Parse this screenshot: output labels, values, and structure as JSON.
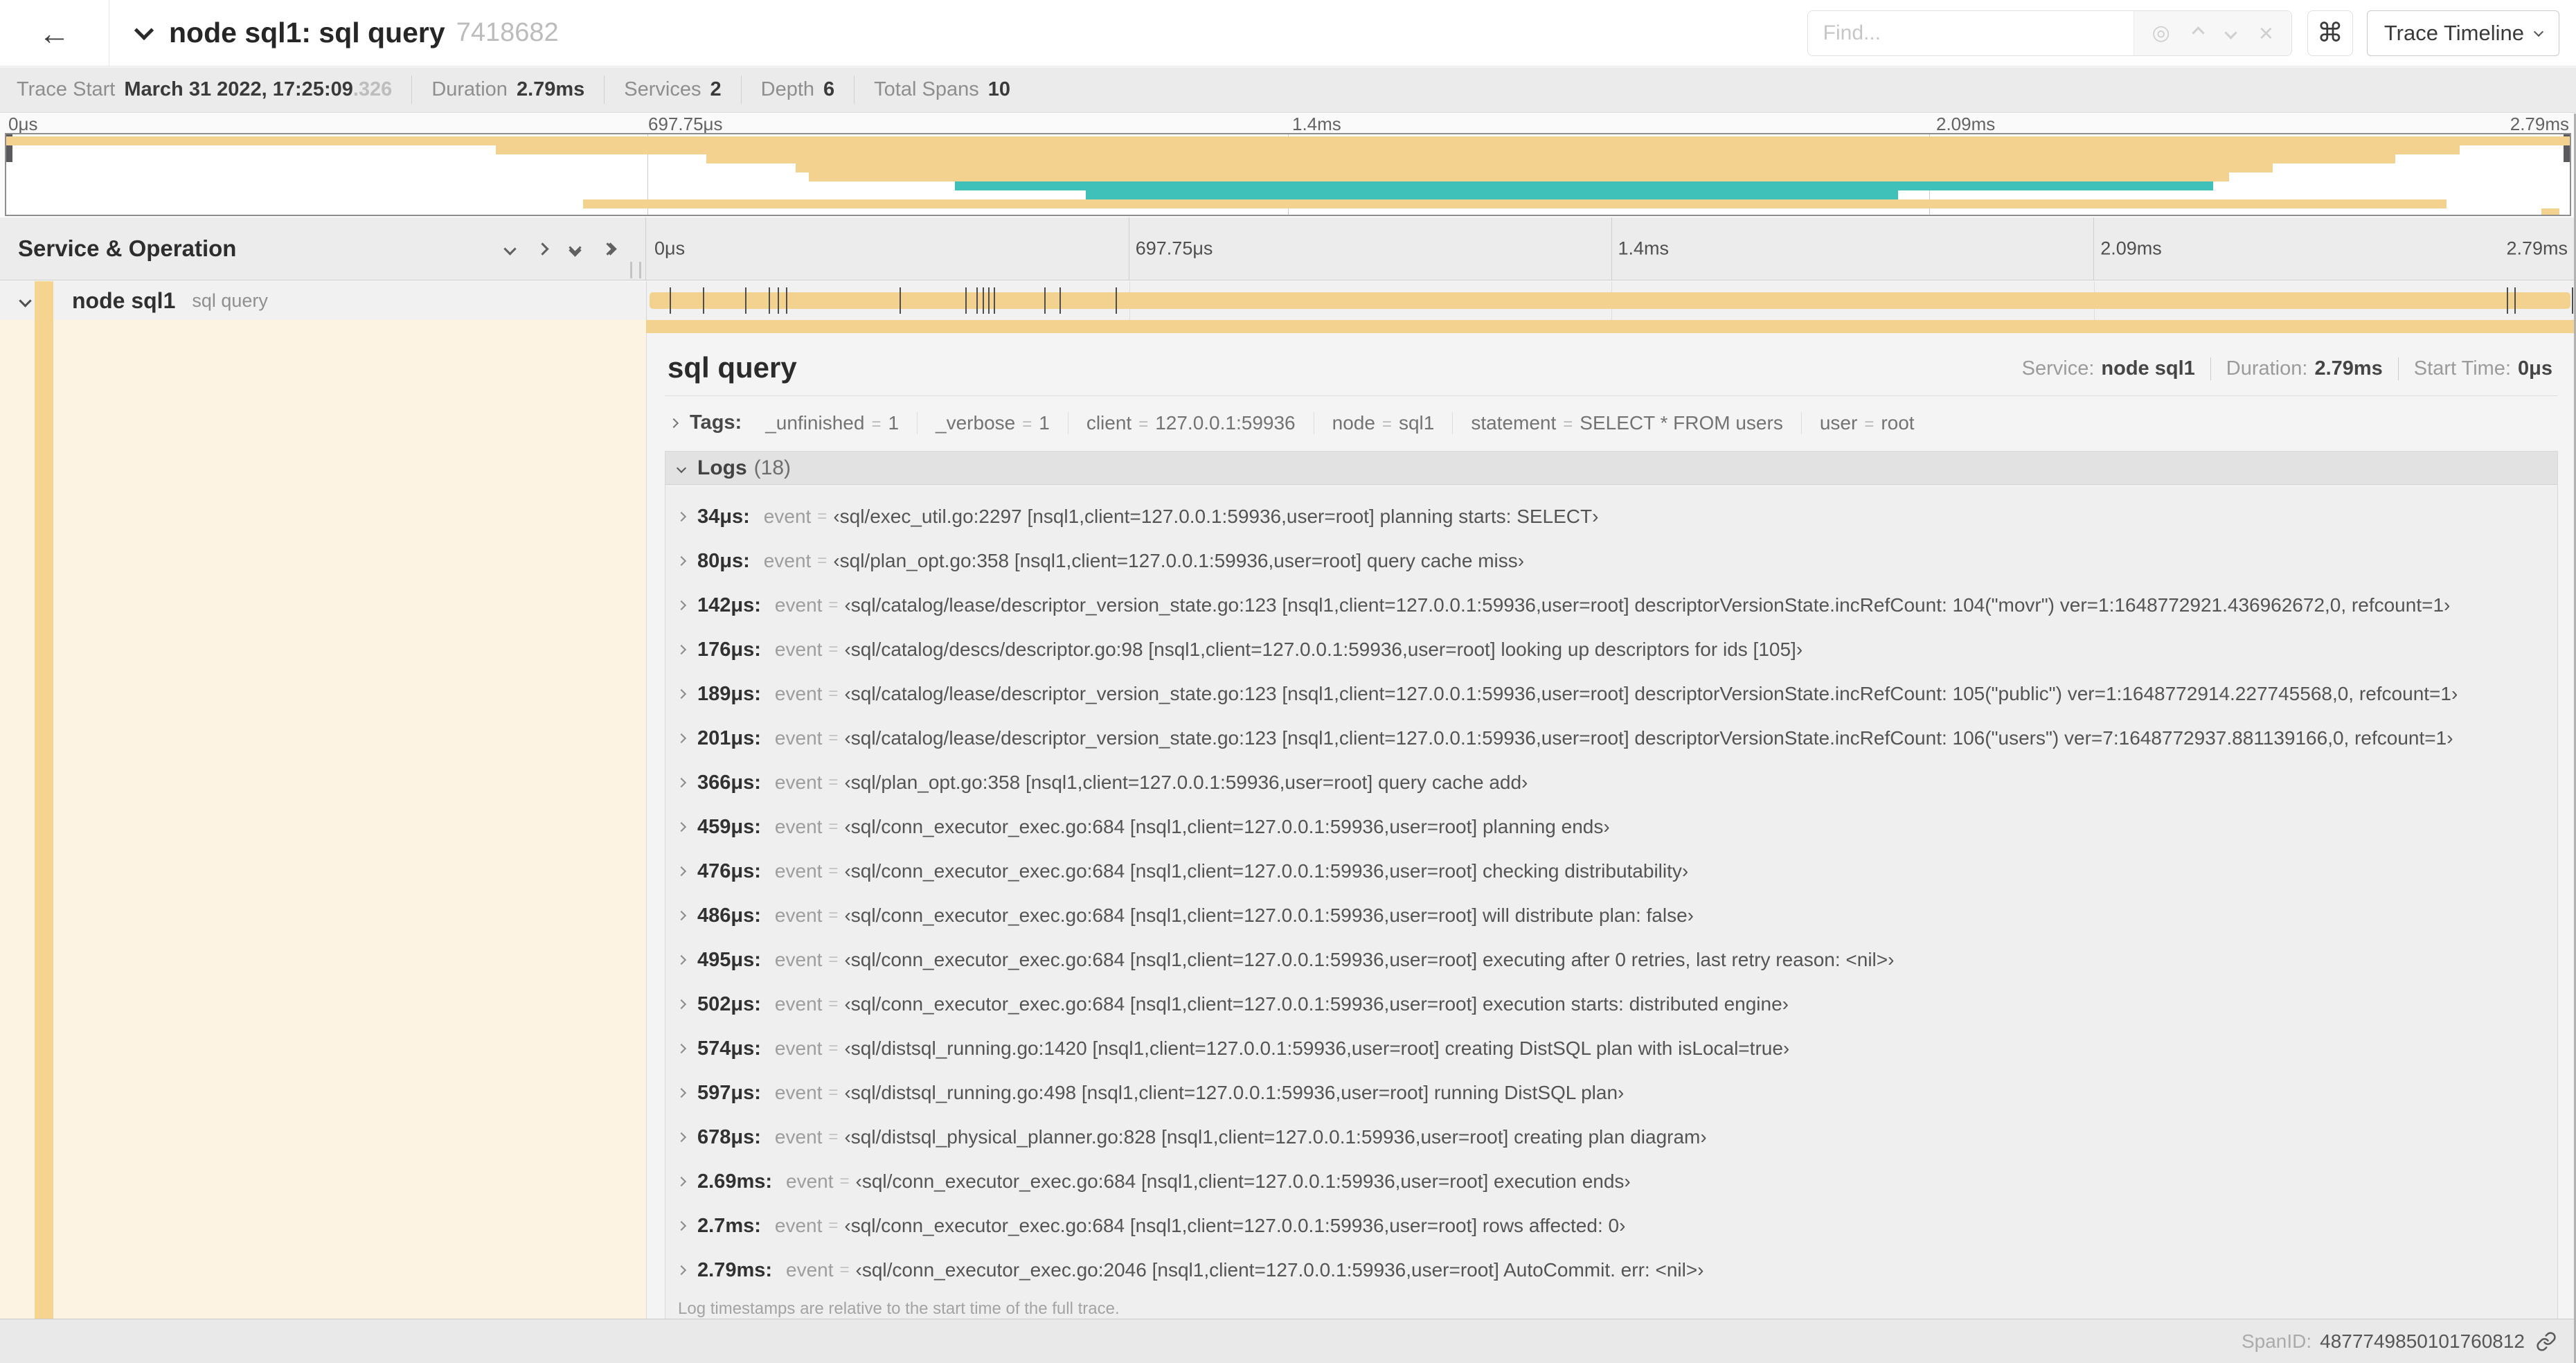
{
  "colors": {
    "tan": "#f2d28e",
    "teal": "#3fc1b9",
    "tan_pale": "#fdf3e2",
    "tan_stripe": "#f5d48f"
  },
  "header": {
    "back_icon": "back-arrow",
    "title": "node sql1: sql query",
    "trace_id": "7418682",
    "find_placeholder": "Find...",
    "shortcut_key": "⌘",
    "view_button": "Trace Timeline"
  },
  "summary": {
    "items": [
      {
        "label": "Trace Start",
        "value": "March 31 2022, 17:25:09",
        "value_muted": ".326"
      },
      {
        "label": "Duration",
        "value": "2.79ms"
      },
      {
        "label": "Services",
        "value": "2"
      },
      {
        "label": "Depth",
        "value": "6"
      },
      {
        "label": "Total Spans",
        "value": "10"
      }
    ]
  },
  "ruler": {
    "labels": [
      "0μs",
      "697.75μs",
      "1.4ms",
      "2.09ms",
      "2.79ms"
    ]
  },
  "minimap": {
    "bars": [
      {
        "row": 0,
        "start": 0,
        "end": 100,
        "color": "tan"
      },
      {
        "row": 1,
        "start": 19.1,
        "end": 95.7,
        "color": "tan"
      },
      {
        "row": 2,
        "start": 27.3,
        "end": 93.2,
        "color": "tan"
      },
      {
        "row": 3,
        "start": 30.8,
        "end": 88.4,
        "color": "tan"
      },
      {
        "row": 4,
        "start": 31.3,
        "end": 86.7,
        "color": "tan"
      },
      {
        "row": 5,
        "start": 37.0,
        "end": 86.1,
        "color": "teal"
      },
      {
        "row": 6,
        "start": 42.1,
        "end": 73.8,
        "color": "teal"
      },
      {
        "row": 7,
        "start": 22.5,
        "end": 95.2,
        "color": "tan"
      },
      {
        "row": 8,
        "start": 98.9,
        "end": 99.6,
        "color": "tan"
      }
    ]
  },
  "timeline_header": {
    "label": "Service & Operation"
  },
  "span_row": {
    "service": "node sql1",
    "operation": "sql query",
    "ticks_pct": [
      1.2,
      2.9,
      5.1,
      6.3,
      6.8,
      7.2,
      13.1,
      16.5,
      17.1,
      17.4,
      17.7,
      18.0,
      20.6,
      21.4,
      24.3,
      96.4,
      96.8,
      99.8
    ]
  },
  "detail": {
    "title": "sql query",
    "service_label": "Service:",
    "service": "node sql1",
    "duration_label": "Duration:",
    "duration": "2.79ms",
    "start_label": "Start Time:",
    "start": "0μs",
    "tags_label": "Tags:",
    "tags": [
      {
        "key": "_unfinished",
        "value": "1"
      },
      {
        "key": "_verbose",
        "value": "1"
      },
      {
        "key": "client",
        "value": "127.0.0.1:59936"
      },
      {
        "key": "node",
        "value": "sql1"
      },
      {
        "key": "statement",
        "value": "SELECT * FROM users"
      },
      {
        "key": "user",
        "value": "root"
      }
    ],
    "logs_label": "Logs",
    "logs_count": "(18)",
    "logs": [
      {
        "t": "34μs:",
        "k": "event",
        "v": "‹sql/exec_util.go:2297 [nsql1,client=127.0.0.1:59936,user=root] planning starts: SELECT›"
      },
      {
        "t": "80μs:",
        "k": "event",
        "v": "‹sql/plan_opt.go:358 [nsql1,client=127.0.0.1:59936,user=root] query cache miss›"
      },
      {
        "t": "142μs:",
        "k": "event",
        "v": "‹sql/catalog/lease/descriptor_version_state.go:123 [nsql1,client=127.0.0.1:59936,user=root] descriptorVersionState.incRefCount: 104(\"movr\") ver=1:1648772921.436962672,0, refcount=1›"
      },
      {
        "t": "176μs:",
        "k": "event",
        "v": "‹sql/catalog/descs/descriptor.go:98 [nsql1,client=127.0.0.1:59936,user=root] looking up descriptors for ids [105]›"
      },
      {
        "t": "189μs:",
        "k": "event",
        "v": "‹sql/catalog/lease/descriptor_version_state.go:123 [nsql1,client=127.0.0.1:59936,user=root] descriptorVersionState.incRefCount: 105(\"public\") ver=1:1648772914.227745568,0, refcount=1›"
      },
      {
        "t": "201μs:",
        "k": "event",
        "v": "‹sql/catalog/lease/descriptor_version_state.go:123 [nsql1,client=127.0.0.1:59936,user=root] descriptorVersionState.incRefCount: 106(\"users\") ver=7:1648772937.881139166,0, refcount=1›"
      },
      {
        "t": "366μs:",
        "k": "event",
        "v": "‹sql/plan_opt.go:358 [nsql1,client=127.0.0.1:59936,user=root] query cache add›"
      },
      {
        "t": "459μs:",
        "k": "event",
        "v": "‹sql/conn_executor_exec.go:684 [nsql1,client=127.0.0.1:59936,user=root] planning ends›"
      },
      {
        "t": "476μs:",
        "k": "event",
        "v": "‹sql/conn_executor_exec.go:684 [nsql1,client=127.0.0.1:59936,user=root] checking distributability›"
      },
      {
        "t": "486μs:",
        "k": "event",
        "v": "‹sql/conn_executor_exec.go:684 [nsql1,client=127.0.0.1:59936,user=root] will distribute plan: false›"
      },
      {
        "t": "495μs:",
        "k": "event",
        "v": "‹sql/conn_executor_exec.go:684 [nsql1,client=127.0.0.1:59936,user=root] executing after 0 retries, last retry reason: <nil>›"
      },
      {
        "t": "502μs:",
        "k": "event",
        "v": "‹sql/conn_executor_exec.go:684 [nsql1,client=127.0.0.1:59936,user=root] execution starts: distributed engine›"
      },
      {
        "t": "574μs:",
        "k": "event",
        "v": "‹sql/distsql_running.go:1420 [nsql1,client=127.0.0.1:59936,user=root] creating DistSQL plan with isLocal=true›"
      },
      {
        "t": "597μs:",
        "k": "event",
        "v": "‹sql/distsql_running.go:498 [nsql1,client=127.0.0.1:59936,user=root] running DistSQL plan›"
      },
      {
        "t": "678μs:",
        "k": "event",
        "v": "‹sql/distsql_physical_planner.go:828 [nsql1,client=127.0.0.1:59936,user=root] creating plan diagram›"
      },
      {
        "t": "2.69ms:",
        "k": "event",
        "v": "‹sql/conn_executor_exec.go:684 [nsql1,client=127.0.0.1:59936,user=root] execution ends›"
      },
      {
        "t": "2.7ms:",
        "k": "event",
        "v": "‹sql/conn_executor_exec.go:684 [nsql1,client=127.0.0.1:59936,user=root] rows affected: 0›"
      },
      {
        "t": "2.79ms:",
        "k": "event",
        "v": "‹sql/conn_executor_exec.go:2046 [nsql1,client=127.0.0.1:59936,user=root] AutoCommit. err: <nil>›"
      }
    ],
    "footnote": "Log timestamps are relative to the start time of the full trace.",
    "span_id_label": "SpanID:",
    "span_id": "4877749850101760812"
  }
}
